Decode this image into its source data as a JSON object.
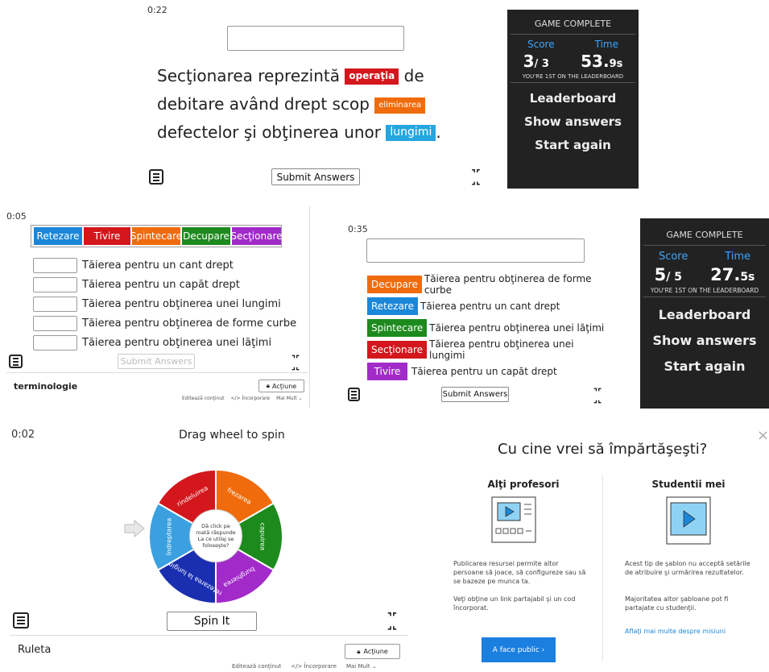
{
  "panel1": {
    "timer": "0:22",
    "sentence": {
      "line1_pre": "Secţionarea reprezintă",
      "tag1": "operaţia",
      "line1_post": "de",
      "line2_pre": "debitare având drept scop",
      "tag2": "eliminarea",
      "line3_pre": "defectelor şi obţinerea unor",
      "tag3": "lungimi",
      "line3_post": "."
    },
    "submit_label": "Submit Answers",
    "game_complete": {
      "title": "GAME COMPLETE",
      "score_label": "Score",
      "time_label": "Time",
      "score_value": "3",
      "score_total": "/ 3",
      "time_value": "53.",
      "time_suffix": "9s",
      "leaderboard_note": "YOU'RE 1ST ON THE LEADERBOARD",
      "menu": [
        "Leaderboard",
        "Show answers",
        "Start again"
      ]
    }
  },
  "panel2": {
    "timer": "0:05",
    "tags": [
      {
        "label": "Retezare",
        "color": "#1b87d9"
      },
      {
        "label": "Tivire",
        "color": "#d3171c"
      },
      {
        "label": "Spintecare",
        "color": "#f06b0b"
      },
      {
        "label": "Decupare",
        "color": "#1d8a1d"
      },
      {
        "label": "Secţionare",
        "color": "#a22ac9"
      }
    ],
    "rows": [
      "Tăierea pentru un cant drept",
      "Tăierea pentru un capăt drept",
      "Tăierea pentru obţinerea unei lungimi",
      "Tăierea pentru obţinerea de forme curbe",
      "Tăierea pentru obţinerea unei lăţimi"
    ],
    "submit_label": "Submit Answers",
    "title": "terminologie",
    "action_label": "Acţiune",
    "footer": [
      "Editează conţinut",
      "</> Încorporare",
      "Mai Mult ⌄"
    ]
  },
  "panel3": {
    "timer": "0:35",
    "rows": [
      {
        "tag": "Decupare",
        "color": "#f06b0b",
        "text": "Tăierea pentru obţinerea de forme curbe"
      },
      {
        "tag": "Retezare",
        "color": "#1b87d9",
        "text": "Tăierea pentru un cant drept"
      },
      {
        "tag": "Spintecare",
        "color": "#1d8a1d",
        "text": "Tăierea pentru obţinerea unei lăţimi"
      },
      {
        "tag": "Secţionare",
        "color": "#d3171c",
        "text": "Tăierea pentru obţinerea unei lungimi"
      },
      {
        "tag": "Tivire",
        "color": "#a22ac9",
        "text": "Tăierea pentru un capăt drept"
      }
    ],
    "submit_label": "Submit Answers",
    "game_complete": {
      "title": "GAME COMPLETE",
      "score_label": "Score",
      "time_label": "Time",
      "score_value": "5",
      "score_total": "/ 5",
      "time_value": "27.",
      "time_suffix": "5s",
      "leaderboard_note": "YOU'RE 1ST ON THE LEADERBOARD",
      "menu": [
        "Leaderboard",
        "Show answers",
        "Start again"
      ]
    }
  },
  "panel4": {
    "timer": "0:02",
    "heading": "Drag wheel to spin",
    "wheel": {
      "center_text": "Dă click pe roată răspunde La ce utilaj se foloseşte?",
      "segments": [
        {
          "label": "frezarea",
          "color": "#f06b0b"
        },
        {
          "label": "capuirea",
          "color": "#1d8a1d"
        },
        {
          "label": "burghierea",
          "color": "#a22ac9"
        },
        {
          "label": "retezarea la lungime",
          "color": "#1a2fb0"
        },
        {
          "label": "îndreptarea",
          "color": "#3aa0e0"
        },
        {
          "label": "rindeluirea",
          "color": "#d3171c"
        }
      ]
    },
    "spin_label": "Spin It",
    "title": "Ruleta",
    "action_label": "Acţiune",
    "footer": [
      "Editează conţinut",
      "</> Încorporare",
      "Mai Mult ⌄"
    ]
  },
  "share": {
    "title": "Cu cine vrei să împărtăşeşti?",
    "close": "×",
    "left": {
      "heading": "Alţi profesori",
      "p1": "Publicarea resursei permite altor persoane să joace, să configureze sau să se bazeze pe munca ta.",
      "p2": "Veţi obţine un link partajabil şi un cod încorporat.",
      "button": "A face public ›"
    },
    "right": {
      "heading": "Studentii mei",
      "p1": "Acest tip de şablon nu acceptă setările de atribuire şi urmărirea rezultatelor.",
      "p2": "Majoritatea altor şabloane pot fi partajate cu studenţii.",
      "link": "Aflaţi mai multe despre misiuni"
    }
  }
}
